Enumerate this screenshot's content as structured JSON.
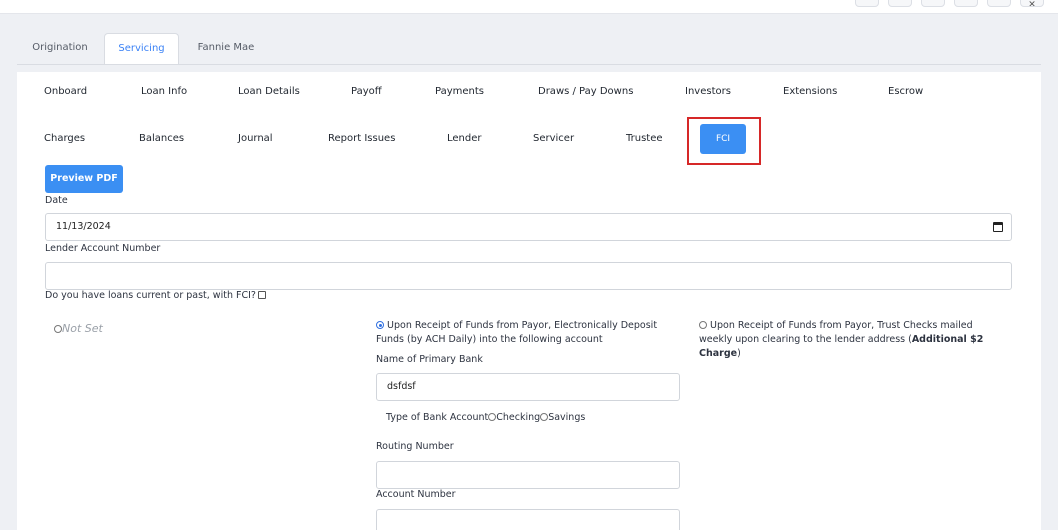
{
  "main_tabs": [
    {
      "label": "Origination"
    },
    {
      "label": "Servicing"
    },
    {
      "label": "Fannie Mae"
    }
  ],
  "sub_tabs_row1": [
    "Onboard",
    "Loan Info",
    "Loan Details",
    "Payoff",
    "Payments",
    "Draws / Pay Downs",
    "Investors",
    "Extensions",
    "Escrow"
  ],
  "sub_tabs_row2": [
    "Charges",
    "Balances",
    "Journal",
    "Report Issues",
    "Lender",
    "Servicer",
    "Trustee"
  ],
  "fci_tab": "FCI",
  "preview_button": "Preview PDF",
  "form": {
    "date_label": "Date",
    "date_value": "11/13/2024",
    "lender_account_label": "Lender Account Number",
    "lender_account_value": "",
    "fci_question": "Do you have loans current or past, with FCI?",
    "not_set": "Not Set",
    "option_ach": "Upon Receipt of Funds from Payor, Electronically Deposit Funds (by ACH Daily) into the following account",
    "option_checks_prefix": "Upon Receipt of Funds from Payor, Trust Checks mailed weekly upon clearing to the lender address (",
    "option_checks_bold": "Additional $2 Charge",
    "option_checks_suffix": ")",
    "primary_bank_label": "Name of Primary Bank",
    "primary_bank_value": "dsfdsf",
    "bank_type_label": "Type of Bank Account",
    "checking_label": "Checking",
    "savings_label": "Savings",
    "routing_label": "Routing Number",
    "routing_value": "",
    "account_label": "Account Number",
    "account_value": ""
  }
}
